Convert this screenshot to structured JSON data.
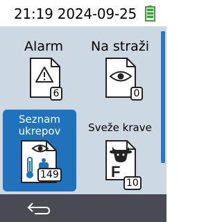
{
  "status": {
    "datetime": "21:19 2024-09-25",
    "battery_color": "#3aa335"
  },
  "tiles": [
    {
      "label": "Alarm",
      "count": "6",
      "icon": "warning-icon"
    },
    {
      "label": "Na straži",
      "count": "0",
      "icon": "eye-icon"
    },
    {
      "label": "Seznam ukrepov",
      "count": "149",
      "icon": "eye-thermometer-icon"
    },
    {
      "label": "Sveže krave",
      "count": "10",
      "icon": "cow-head-icon"
    }
  ],
  "nav": {
    "back_icon": "back-arrow-icon"
  },
  "colors": {
    "accent": "#1f73bd",
    "content_bg": "#cdd9e2",
    "bottombar_bg": "#4a4a55"
  }
}
